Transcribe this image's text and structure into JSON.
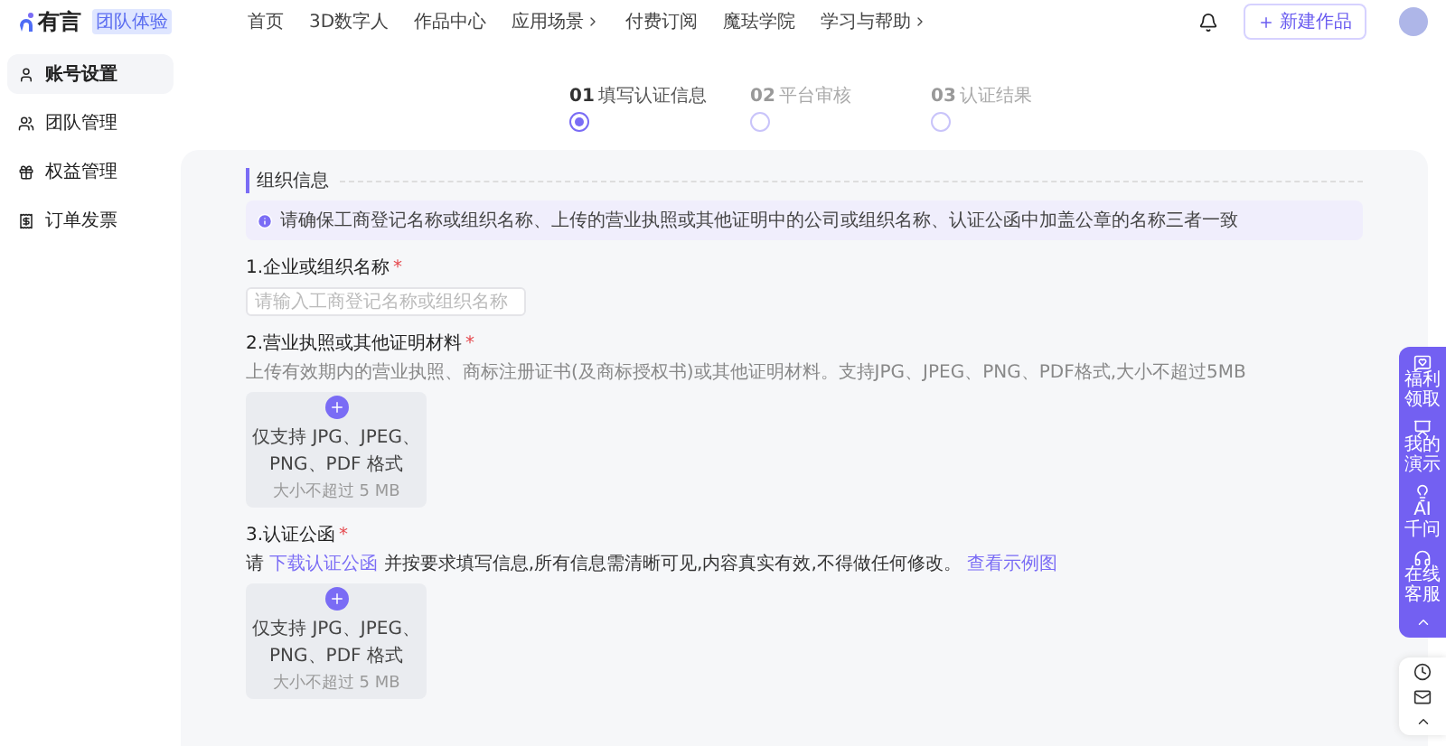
{
  "header": {
    "logo": "有言",
    "badge": "团队体验",
    "nav": [
      {
        "label": "首页",
        "dropdown": false
      },
      {
        "label": "3D数字人",
        "dropdown": false
      },
      {
        "label": "作品中心",
        "dropdown": false
      },
      {
        "label": "应用场景",
        "dropdown": true
      },
      {
        "label": "付费订阅",
        "dropdown": false
      },
      {
        "label": "魔珐学院",
        "dropdown": false
      },
      {
        "label": "学习与帮助",
        "dropdown": true
      }
    ],
    "new_button": "新建作品"
  },
  "sidebar": {
    "items": [
      {
        "label": "账号设置",
        "selected": true
      },
      {
        "label": "团队管理",
        "selected": false
      },
      {
        "label": "权益管理",
        "selected": false
      },
      {
        "label": "订单发票",
        "selected": false
      }
    ]
  },
  "steps": [
    {
      "number": "01",
      "label": "填写认证信息",
      "selected": true
    },
    {
      "number": "02",
      "label": "平台审核",
      "selected": false
    },
    {
      "number": "03",
      "label": "认证结果",
      "selected": false
    }
  ],
  "form": {
    "section_title": "组织信息",
    "notice": "请确保工商登记名称或组织名称、上传的营业执照或其他证明中的公司或组织名称、认证公函中加盖公章的名称三者一致",
    "fields": [
      {
        "kind": "input",
        "label": "1.企业或组织名称",
        "mark": "*",
        "placeholder": "请输入工商登记名称或组织名称"
      },
      {
        "kind": "upload",
        "label": "2.营业执照或其他证明材料",
        "mark": "*",
        "hint": [
          {
            "text": "上传有效期内的营业执照、商标注册证书(及商标授权书)或其他证明材料。支持JPG、JPEG、PNG、PDF格式,大小不超过5MB",
            "link": false
          }
        ],
        "upload": {
          "line1": "仅支持 JPG、JPEG、",
          "line2": "PNG、PDF 格式",
          "size": "大小不超过 5 MB"
        }
      },
      {
        "kind": "upload",
        "label": "3.认证公函",
        "mark": "*",
        "hint": [
          {
            "text": "请 ",
            "link": false
          },
          {
            "text": "下载认证公函",
            "link": true
          },
          {
            "text": " 并按要求填写信息,所有信息需清晰可见,内容真实有效,不得做任何修改。 ",
            "link": false
          },
          {
            "text": "查看示例图",
            "link": true
          }
        ],
        "upload": {
          "line1": "仅支持 JPG、JPEG、",
          "line2": "PNG、PDF 格式",
          "size": "大小不超过 5 MB"
        }
      }
    ]
  },
  "float_tools": [
    {
      "label": "福利领取"
    },
    {
      "label": "我的演示"
    },
    {
      "label": "AI 千问"
    },
    {
      "label": "在线客服"
    }
  ]
}
